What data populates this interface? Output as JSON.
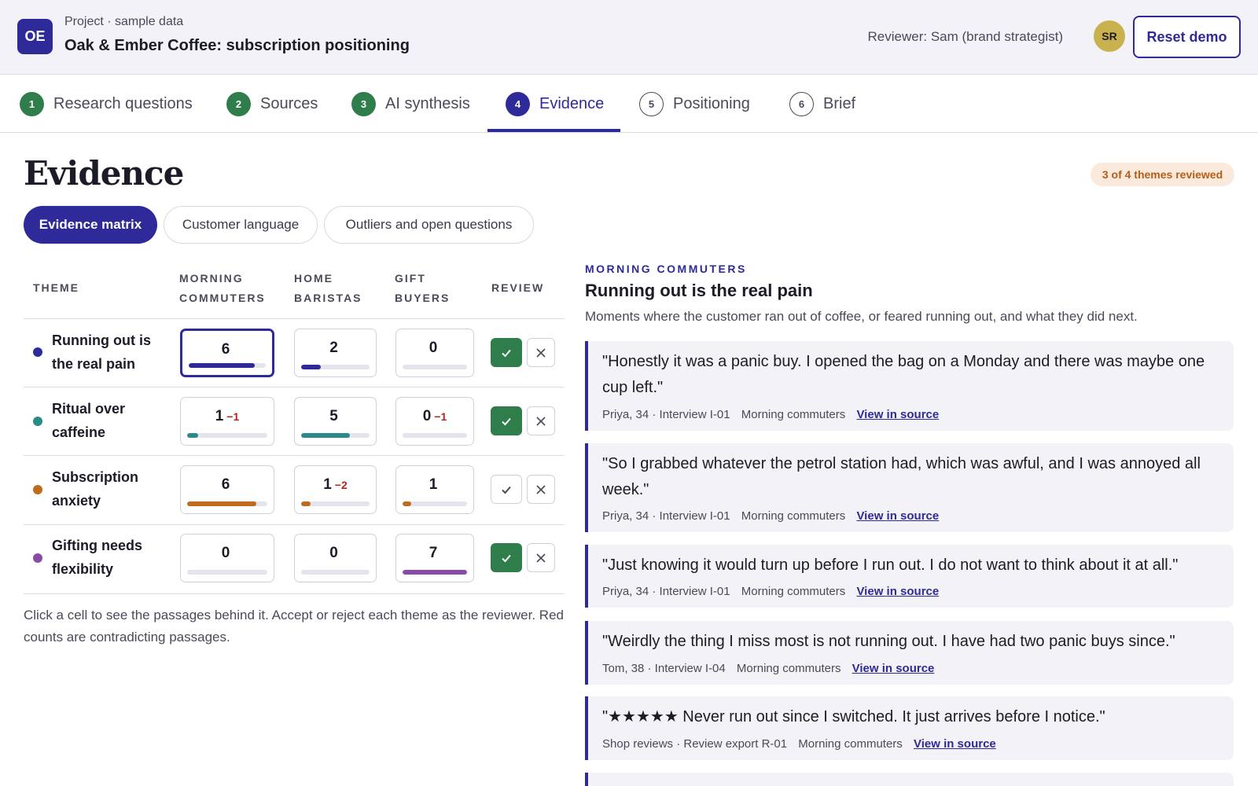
{
  "header": {
    "logo_initials": "OE",
    "kicker": "Project · sample data",
    "title": "Oak & Ember Coffee: subscription positioning",
    "reviewer": "Reviewer: Sam (brand strategist)",
    "avatar_initials": "SR",
    "reset_label": "Reset demo"
  },
  "steps": [
    {
      "num": "1",
      "label": "Research questions",
      "state": "done"
    },
    {
      "num": "2",
      "label": "Sources",
      "state": "done"
    },
    {
      "num": "3",
      "label": "AI synthesis",
      "state": "done"
    },
    {
      "num": "4",
      "label": "Evidence",
      "state": "current"
    },
    {
      "num": "5",
      "label": "Positioning",
      "state": "todo"
    },
    {
      "num": "6",
      "label": "Brief",
      "state": "todo"
    }
  ],
  "page": {
    "title": "Evidence",
    "badge": "3 of 4 themes reviewed"
  },
  "tabs": [
    {
      "label": "Evidence matrix",
      "active": true
    },
    {
      "label": "Customer language",
      "active": false
    },
    {
      "label": "Outliers and open questions",
      "active": false
    }
  ],
  "matrix": {
    "headers": {
      "theme": "THEME",
      "seg1_l1": "MORNING",
      "seg1_l2": "COMMUTERS",
      "seg2_l1": "HOME",
      "seg2_l2": "BARISTAS",
      "seg3_l1": "GIFT",
      "seg3_l2": "BUYERS",
      "review": "REVIEW"
    },
    "rows": [
      {
        "line1": "Running out is",
        "line2": "the real pain",
        "color": "#2e2a9a",
        "cells": [
          {
            "value": "6",
            "neg": "",
            "fill": 0.86
          },
          {
            "value": "2",
            "neg": "",
            "fill": 0.29
          },
          {
            "value": "0",
            "neg": "",
            "fill": 0
          }
        ],
        "accepted": true
      },
      {
        "line1": "Ritual over",
        "line2": "caffeine",
        "color": "#2a8a8a",
        "cells": [
          {
            "value": "1",
            "neg": "−1",
            "fill": 0.14
          },
          {
            "value": "5",
            "neg": "",
            "fill": 0.71
          },
          {
            "value": "0",
            "neg": "−1",
            "fill": 0
          }
        ],
        "accepted": true
      },
      {
        "line1": "Subscription",
        "line2": "anxiety",
        "color": "#c06a1e",
        "cells": [
          {
            "value": "6",
            "neg": "",
            "fill": 0.86
          },
          {
            "value": "1",
            "neg": "−2",
            "fill": 0.14
          },
          {
            "value": "1",
            "neg": "",
            "fill": 0.14
          }
        ],
        "accepted": false
      },
      {
        "line1": "Gifting needs",
        "line2": "flexibility",
        "color": "#8a4aa6",
        "cells": [
          {
            "value": "0",
            "neg": "",
            "fill": 0
          },
          {
            "value": "0",
            "neg": "",
            "fill": 0
          },
          {
            "value": "7",
            "neg": "",
            "fill": 1.0
          }
        ],
        "accepted": true
      }
    ],
    "footnote": "Click a cell to see the passages behind it. Accept or reject each theme as the reviewer. Red counts are contradicting passages."
  },
  "panel": {
    "kicker": "MORNING COMMUTERS",
    "title": "Running out is the real pain",
    "description": "Moments where the customer ran out of coffee, or feared running out, and what they did next.",
    "link_label": "View in source",
    "quotes": [
      {
        "text": "\"Honestly it was a panic buy. I opened the bag on a Monday and there was maybe one cup left.\"",
        "source": "Priya, 34 · Interview I-01",
        "segment": "Morning commuters"
      },
      {
        "text": "\"So I grabbed whatever the petrol station had, which was awful, and I was annoyed all week.\"",
        "source": "Priya, 34 · Interview I-01",
        "segment": "Morning commuters"
      },
      {
        "text": "\"Just knowing it would turn up before I run out. I do not want to think about it at all.\"",
        "source": "Priya, 34 · Interview I-01",
        "segment": "Morning commuters"
      },
      {
        "text": "\"Weirdly the thing I miss most is not running out. I have had two panic buys since.\"",
        "source": "Tom, 38 · Interview I-04",
        "segment": "Morning commuters"
      },
      {
        "text": "\"★★★★★ Never run out since I switched. It just arrives before I notice.\"",
        "source": "Shop reviews · Review export R-01",
        "segment": "Morning commuters"
      }
    ]
  }
}
